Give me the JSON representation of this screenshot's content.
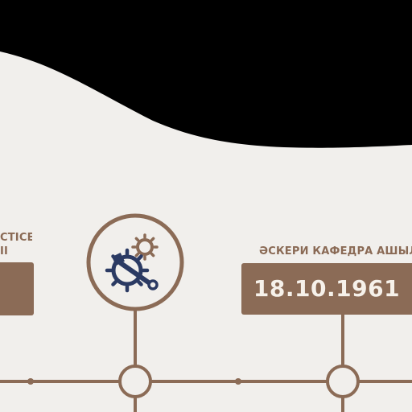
{
  "timeline": {
    "left_card": {
      "heading": "CTICE",
      "subheading": "II",
      "date": ""
    },
    "right_card": {
      "heading": "ӘСКЕРИ КАФЕДРА АШЫЛДЫ",
      "date": "18.10.1961"
    },
    "center_icon": "gear-wrench-icon"
  },
  "colors": {
    "wall": "#f2f0ed",
    "brown": "#8b6b56",
    "card": "#8b6b56",
    "icon": "#2b3a63",
    "ceiling": "#000000"
  }
}
